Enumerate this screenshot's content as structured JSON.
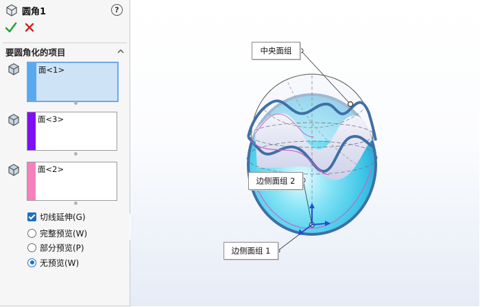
{
  "panel": {
    "title": "圆角1",
    "help_label": "?",
    "section_title": "要圆角化的项目",
    "selections": [
      {
        "value": "面<1>",
        "color": "#5aa8f0",
        "active": true
      },
      {
        "value": "面<3>",
        "color": "#7f10f5",
        "active": false
      },
      {
        "value": "面<2>",
        "color": "#f77fbd",
        "active": false
      }
    ],
    "checkbox": {
      "label": "切线延伸(G)",
      "checked": true
    },
    "radios": [
      {
        "label": "完整预览(W)",
        "checked": false
      },
      {
        "label": "部分预览(P)",
        "checked": false
      },
      {
        "label": "无预览(W)",
        "checked": true
      }
    ]
  },
  "viewport": {
    "callouts": [
      "中央面组",
      "边侧面组 2",
      "边侧面组 1"
    ]
  },
  "colors": {
    "accent": "#1f6fc0",
    "ok_green": "#22a338",
    "cancel_red": "#d42020",
    "model_cyan": "#4fd2ee",
    "edge_blue": "#3f6fa6",
    "edge_pink": "#d060c0"
  },
  "icons": [
    "part-icon",
    "help-icon",
    "ok-check-icon",
    "cancel-x-icon",
    "collapse-chevron-icon",
    "face-icon",
    "triad-icon"
  ]
}
